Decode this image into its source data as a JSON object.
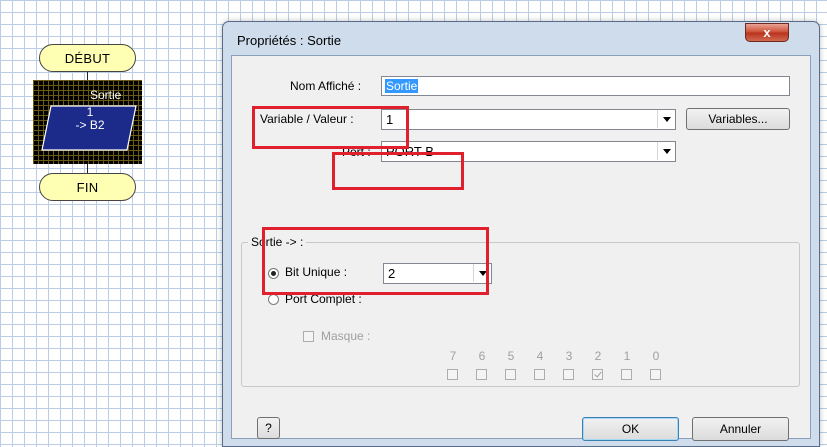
{
  "flowchart": {
    "start_label": "DÉBUT",
    "end_label": "FIN",
    "output_block": {
      "title": "Sortie",
      "line1": "1",
      "line2": "-> B2"
    }
  },
  "dialog": {
    "title": "Propriétés : Sortie",
    "close_glyph": "x",
    "name_label": "Nom Affiché :",
    "name_value": "Sortie",
    "variable_label": "Variable / Valeur :",
    "variable_value": "1",
    "variables_button": "Variables...",
    "port_label": "Port :",
    "port_value": "PORT B",
    "group_title": "Sortie -> :",
    "bit_unique_label": "Bit Unique :",
    "bit_unique_value": "2",
    "port_complet_label": "Port Complet :",
    "masque_label": "Masque :",
    "bits": [
      "7",
      "6",
      "5",
      "4",
      "3",
      "2",
      "1",
      "0"
    ],
    "bits_checked": [
      false,
      false,
      false,
      false,
      false,
      true,
      false,
      false
    ],
    "help_button": "?",
    "ok_button": "OK",
    "cancel_button": "Annuler",
    "mode_selected": "bit_unique"
  },
  "colors": {
    "highlight": "#e0202c",
    "terminal_fill": "#ffffb3",
    "output_fill": "#1c2a8a"
  }
}
